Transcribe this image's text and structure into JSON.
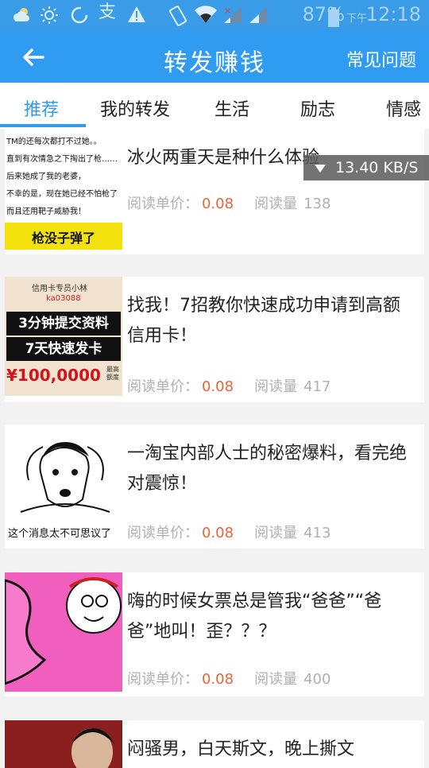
{
  "status_bar": {
    "battery_percent": "87%",
    "clock_ampm": "下午",
    "clock_time": "12:18"
  },
  "header": {
    "title": "转发赚钱",
    "faq_label": "常见问题"
  },
  "tabs": [
    {
      "label": "推荐",
      "active": true
    },
    {
      "label": "我的转发",
      "active": false
    },
    {
      "label": "生活",
      "active": false
    },
    {
      "label": "励志",
      "active": false
    },
    {
      "label": "情感",
      "active": false
    }
  ],
  "price_label": "阅读单价：",
  "views_label": "阅读量",
  "articles": [
    {
      "title": "冰火两重天是种什么体验",
      "price": "0.08",
      "views": "138",
      "thumb_text": [
        "TM的还每次都打不过她。。",
        "直到有次情急之下掏出了枪……",
        "后来她成了我的老婆，",
        "不幸的是，现在她已经不怕枪了",
        "而且还用靶子威胁我！",
        "枪没子弹了"
      ]
    },
    {
      "title": "找我！7招教你快速成功申请到高额信用卡！",
      "price": "0.08",
      "views": "417",
      "thumb_text": [
        "信用卡专员小林",
        "ka03088",
        "3分钟提交资料",
        "7天快速发卡",
        "¥100,0000",
        "最高额度"
      ]
    },
    {
      "title": "一淘宝内部人士的秘密爆料，看完绝对震惊！",
      "price": "0.08",
      "views": "413",
      "thumb_text": [
        "这个消息太不可思议了"
      ]
    },
    {
      "title": "嗨的时候女票总是管我“爸爸”“爸爸”地叫！歪？？？",
      "price": "0.08",
      "views": "400",
      "thumb_text": []
    },
    {
      "title": "闷骚男，白天斯文，晚上撕文",
      "price": "",
      "views": "",
      "thumb_text": []
    }
  ],
  "speed_indicator": "13.40 KB/S",
  "colors": {
    "primary": "#2f9cf1",
    "price": "#e8643a",
    "muted": "#b0b0b0"
  }
}
